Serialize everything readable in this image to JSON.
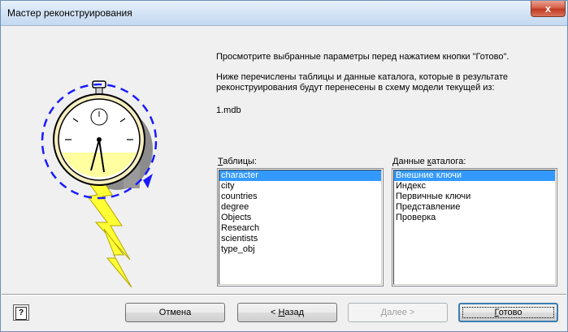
{
  "window": {
    "title": "Мастер реконструирования",
    "close_glyph": "x"
  },
  "intro": {
    "line1": "Просмотрите выбранные параметры перед нажатием кнопки \"Готово\".",
    "line2": "Ниже перечислены таблицы и данные каталога, которые в результате",
    "line3": "реконструирования будут перенесены в схему модели текущей из:",
    "source_file": "1.mdb"
  },
  "tables": {
    "label_accel": "Т",
    "label_rest": "аблицы:",
    "items": [
      "character",
      "city",
      "countries",
      "degree",
      "Objects",
      "Research",
      "scientists",
      "type_obj"
    ],
    "selected_index": 0
  },
  "catalog": {
    "label_pre": "Данные ",
    "label_accel": "к",
    "label_rest": "аталога:",
    "items": [
      "Внешние ключи",
      "Индекс",
      "Первичные ключи",
      "Представление",
      "Проверка"
    ],
    "selected_index": 0
  },
  "footer": {
    "help_glyph": "?",
    "cancel_label": "Отмена",
    "back_prefix": "< ",
    "back_accel": "Н",
    "back_rest": "азад",
    "next_accel": "Д",
    "next_rest": "алее >",
    "finish_accel": "Г",
    "finish_rest": "отово"
  },
  "colors": {
    "selection": "#3399ff",
    "arrow_blue": "#1a1aff",
    "bolt_yellow": "#ffff33"
  },
  "icons": {
    "illustration": "stopwatch-lightning-icon",
    "help": "help-icon",
    "close": "close-icon"
  }
}
